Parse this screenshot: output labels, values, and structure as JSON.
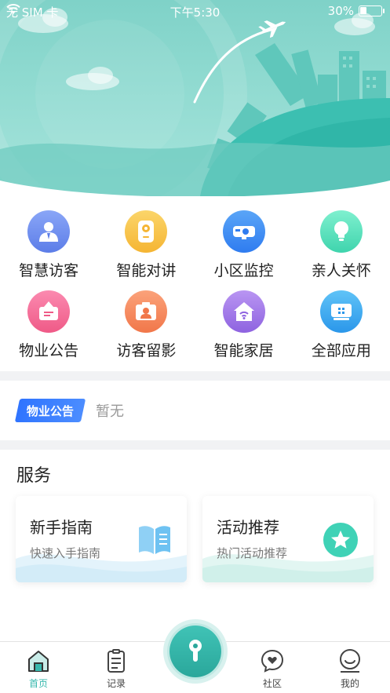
{
  "status_bar": {
    "carrier": "无 SIM 卡",
    "time": "下午5:30",
    "battery_percent": "30%",
    "battery_level": 0.3
  },
  "apps": [
    {
      "label": "智慧访客",
      "icon": "visitor-icon",
      "color": "#6c8df0"
    },
    {
      "label": "智能对讲",
      "icon": "intercom-icon",
      "color": "#f7c347"
    },
    {
      "label": "小区监控",
      "icon": "camera-icon",
      "color": "#3f8ff4"
    },
    {
      "label": "亲人关怀",
      "icon": "bulb-icon",
      "color": "#4fe0bc"
    },
    {
      "label": "物业公告",
      "icon": "notice-icon",
      "color": "#f36a95"
    },
    {
      "label": "访客留影",
      "icon": "photo-icon",
      "color": "#f58a5b"
    },
    {
      "label": "智能家居",
      "icon": "smart-home-icon",
      "color": "#a17be9"
    },
    {
      "label": "全部应用",
      "icon": "all-apps-icon",
      "color": "#3aa7f0"
    }
  ],
  "notice": {
    "tag": "物业公告",
    "text": "暂无"
  },
  "services": {
    "title": "服务",
    "cards": [
      {
        "title": "新手指南",
        "subtitle": "快速入手指南",
        "icon": "book-icon"
      },
      {
        "title": "活动推荐",
        "subtitle": "热门活动推荐",
        "icon": "star-icon"
      }
    ]
  },
  "tabbar": {
    "tabs": [
      {
        "label": "首页",
        "icon": "home-icon",
        "active": true
      },
      {
        "label": "记录",
        "icon": "records-icon",
        "active": false
      },
      {
        "label": "社区",
        "icon": "community-icon",
        "active": false
      },
      {
        "label": "我的",
        "icon": "profile-icon",
        "active": false
      }
    ],
    "center_icon": "key-icon"
  },
  "colors": {
    "accent": "#37b8ad",
    "notice_tag": "#2f74ff"
  }
}
